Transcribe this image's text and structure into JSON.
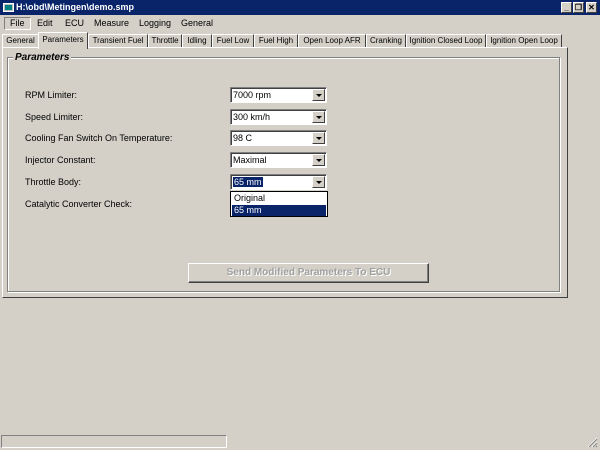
{
  "window": {
    "title": "H:\\obd\\Metingen\\demo.smp",
    "minimize_glyph": "_",
    "restore_glyph": "❐",
    "close_glyph": "✕"
  },
  "menu": {
    "items": [
      "File",
      "Edit",
      "ECU",
      "Measure",
      "Logging",
      "General"
    ],
    "active": "File"
  },
  "tabs": {
    "items": [
      "General",
      "Parameters",
      "Transient Fuel",
      "Throttle",
      "Idling",
      "Fuel Low",
      "Fuel High",
      "Open Loop AFR",
      "Cranking",
      "Ignition Closed Loop",
      "Ignition Open Loop"
    ],
    "active": "Parameters"
  },
  "parameters": {
    "group_title": "Parameters",
    "rows": [
      {
        "label": "RPM Limiter:",
        "value": "7000 rpm"
      },
      {
        "label": "Speed Limiter:",
        "value": "300 km/h"
      },
      {
        "label": "Cooling Fan Switch On Temperature:",
        "value": "98 C"
      },
      {
        "label": "Injector Constant:",
        "value": "Maximal"
      },
      {
        "label": "Throttle Body:",
        "value": "65 mm"
      },
      {
        "label": "Catalytic Converter Check:",
        "value": ""
      }
    ],
    "dropdown": {
      "options": [
        "Original",
        "65 mm"
      ],
      "selected": "65 mm"
    },
    "send_button": "Send Modified Parameters To ECU"
  },
  "colors": {
    "face": "#d4d0c8",
    "title_bar": "#0a246a",
    "selection": "#0a246a",
    "disabled_text": "#a0a0a0"
  }
}
